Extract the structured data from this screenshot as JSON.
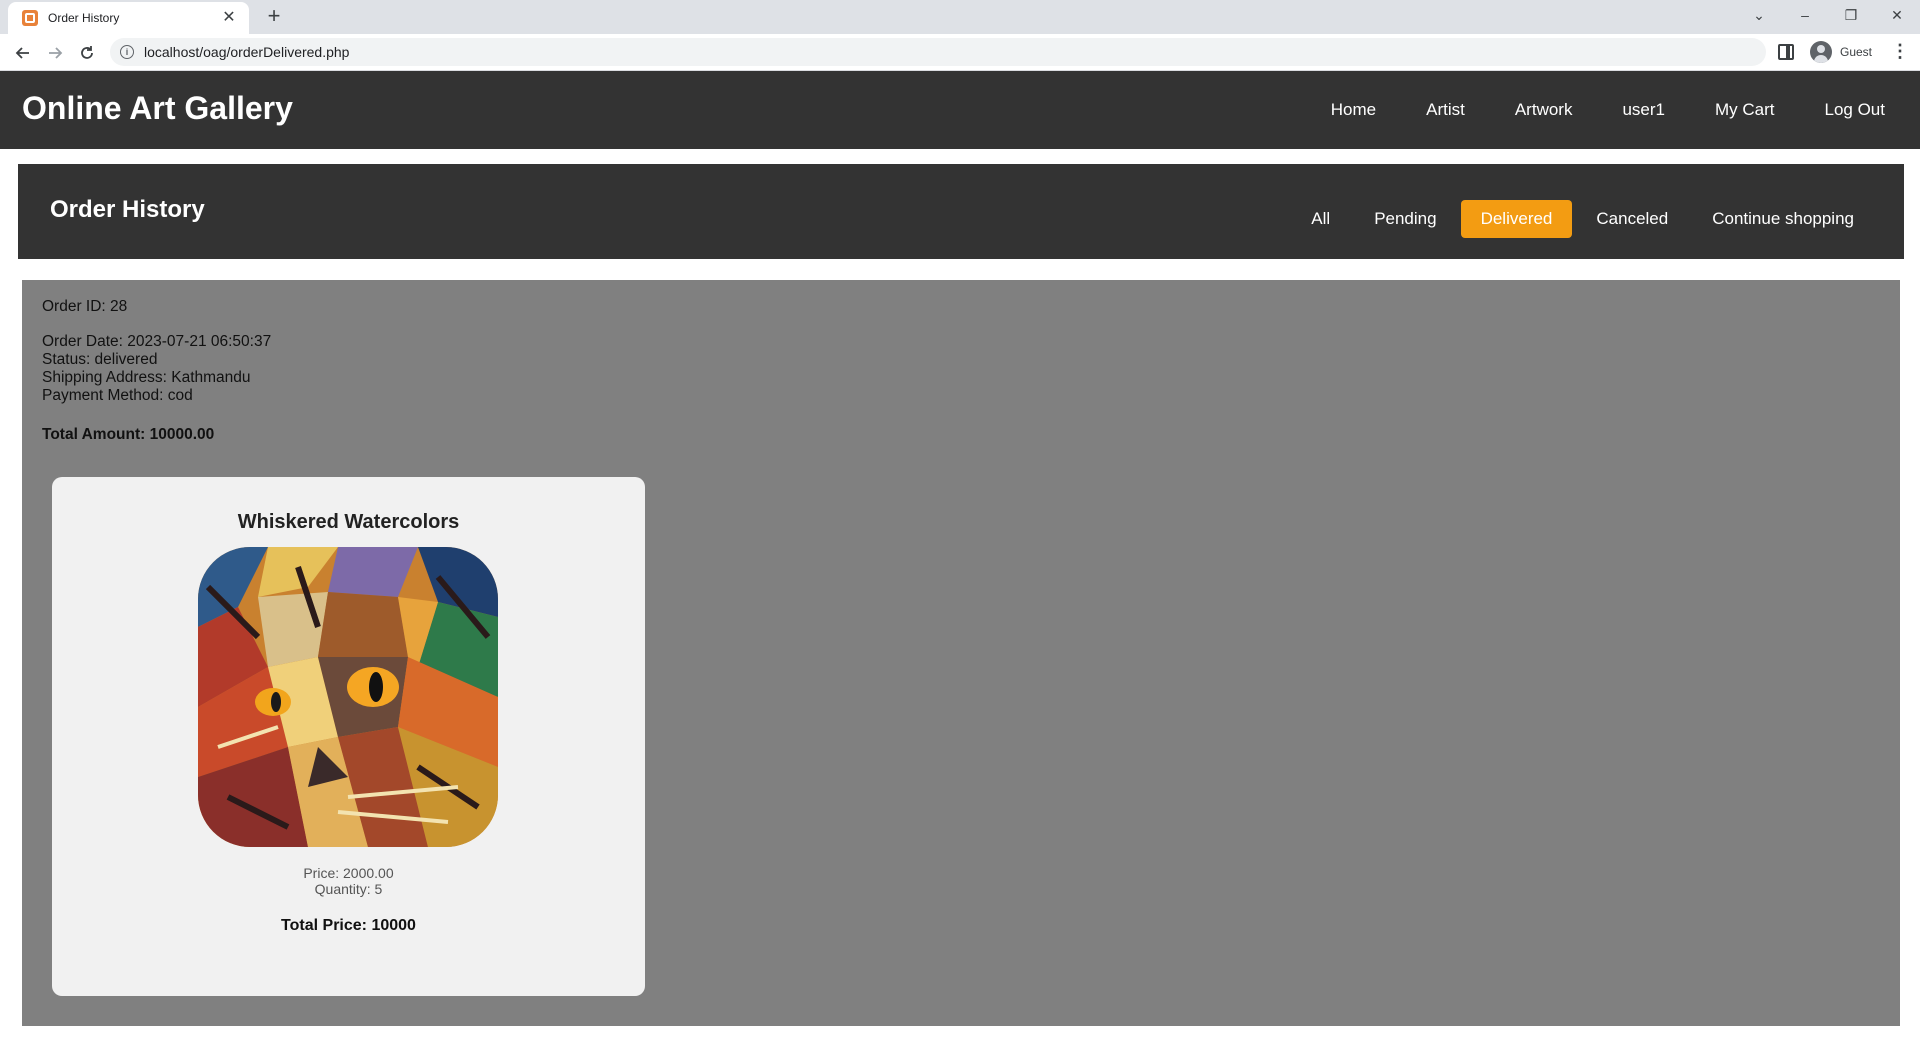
{
  "browser": {
    "tab_title": "Order History",
    "tab_close": "✕",
    "new_tab": "+",
    "url": "localhost/oag/orderDelivered.php",
    "profile_label": "Guest",
    "window_controls": [
      "⌄",
      "–",
      "❐",
      "✕"
    ]
  },
  "site": {
    "title": "Online Art Gallery",
    "nav": [
      {
        "label": "Home"
      },
      {
        "label": "Artist"
      },
      {
        "label": "Artwork"
      },
      {
        "label": "user1"
      },
      {
        "label": "My Cart"
      },
      {
        "label": "Log Out"
      }
    ]
  },
  "history": {
    "title": "Order History",
    "tabs": [
      {
        "label": "All",
        "active": false
      },
      {
        "label": "Pending",
        "active": false
      },
      {
        "label": "Delivered",
        "active": true
      },
      {
        "label": "Canceled",
        "active": false
      },
      {
        "label": "Continue shopping",
        "active": false
      }
    ],
    "active_color": "#f39c12"
  },
  "order": {
    "id_line": "Order ID: 28",
    "date_line": "Order Date: 2023-07-21 06:50:37",
    "status_line": "Status: delivered",
    "address_line": "Shipping Address: Kathmandu",
    "payment_line": "Payment Method: cod",
    "total_line": "Total Amount: 10000.00",
    "items": [
      {
        "name": "Whiskered Watercolors",
        "price_line": "Price: 2000.00",
        "qty_line": "Quantity: 5",
        "total_line": "Total Price: 10000"
      }
    ]
  }
}
